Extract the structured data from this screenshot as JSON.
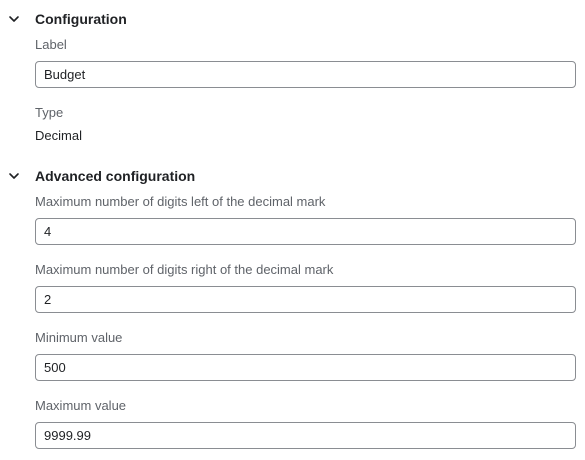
{
  "configuration": {
    "title": "Configuration",
    "chevron_icon": "chevron-down-icon",
    "label": {
      "label": "Label",
      "value": "Budget"
    },
    "type": {
      "label": "Type",
      "value": "Decimal"
    }
  },
  "advanced": {
    "title": "Advanced configuration",
    "chevron_icon": "chevron-down-icon",
    "max_left_digits": {
      "label": "Maximum number of digits left of the decimal mark",
      "value": "4"
    },
    "max_right_digits": {
      "label": "Maximum number of digits right of the decimal mark",
      "value": "2"
    },
    "min_value": {
      "label": "Minimum value",
      "value": "500"
    },
    "max_value": {
      "label": "Maximum value",
      "value": "9999.99"
    }
  },
  "colors": {
    "text": "#1f2124",
    "label": "#5f6369",
    "border": "#8a8d92"
  }
}
